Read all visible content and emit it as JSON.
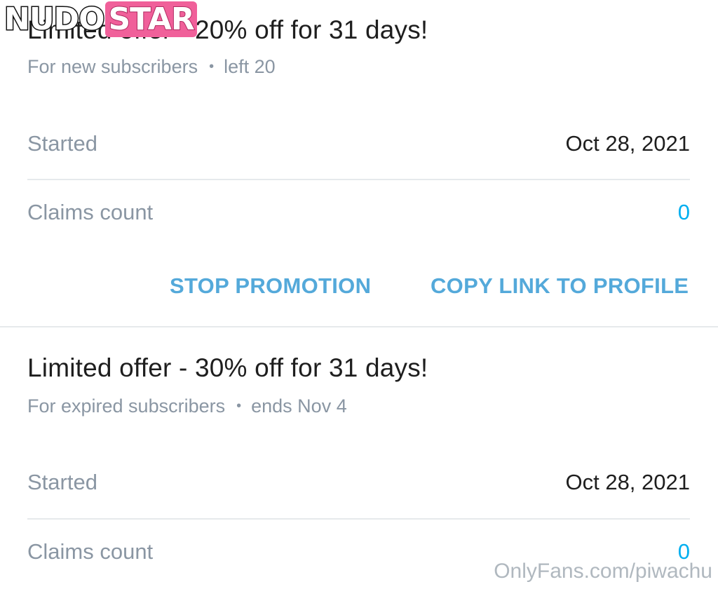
{
  "watermark_logo": {
    "part1": "NUDO",
    "part2": "STAR"
  },
  "promotions": [
    {
      "title": "Limited offer - 20% off for 31 days!",
      "audience": "For new subscribers",
      "meta": "left 20",
      "started_label": "Started",
      "started_value": "Oct 28, 2021",
      "claims_label": "Claims count",
      "claims_value": "0",
      "stop_label": "STOP PROMOTION",
      "copy_label": "COPY LINK TO PROFILE"
    },
    {
      "title": "Limited offer - 30% off for 31 days!",
      "audience": "For expired subscribers",
      "meta": "ends Nov 4",
      "started_label": "Started",
      "started_value": "Oct 28, 2021",
      "claims_label": "Claims count",
      "claims_value": "0"
    }
  ],
  "watermark_text": "OnlyFans.com/piwachu",
  "colors": {
    "accent": "#00aff0",
    "button": "#54a9da",
    "muted": "#8a96a3"
  }
}
